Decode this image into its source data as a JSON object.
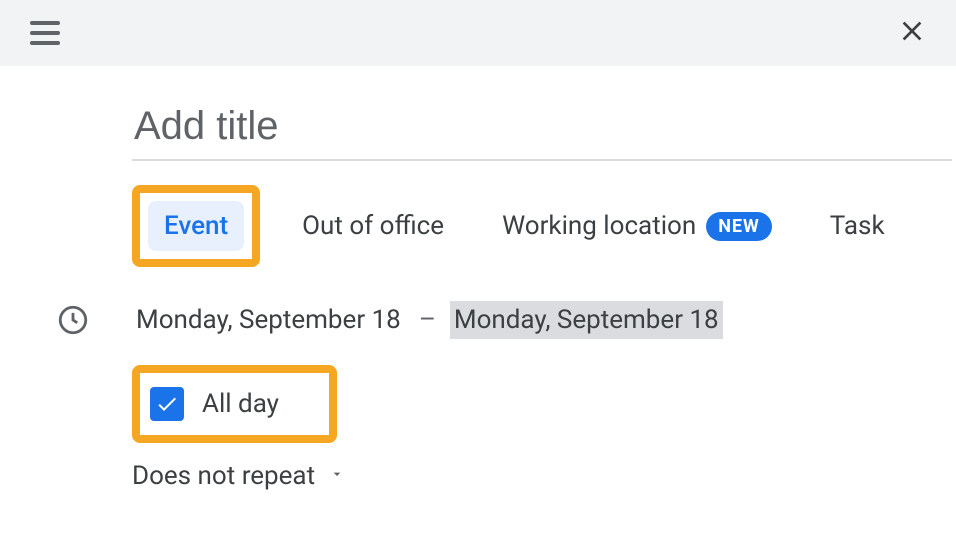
{
  "title": {
    "placeholder": "Add title",
    "value": ""
  },
  "tabs": {
    "event": "Event",
    "ooo": "Out of office",
    "wl": "Working location",
    "wl_badge": "NEW",
    "task": "Task"
  },
  "dates": {
    "start": "Monday, September 18",
    "end": "Monday, September 18",
    "dash": "–"
  },
  "allday": {
    "label": "All day",
    "checked": true
  },
  "repeat": {
    "label": "Does not repeat"
  }
}
